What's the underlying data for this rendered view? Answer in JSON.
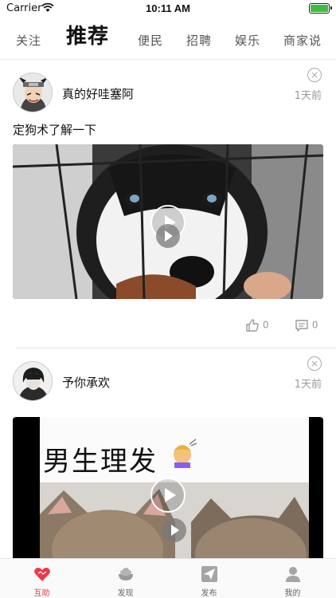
{
  "status_bar": {
    "carrier": "Carrier",
    "time": "10:11 AM"
  },
  "top_tabs": [
    {
      "label": "关注",
      "active": false
    },
    {
      "label": "推荐",
      "active": true
    },
    {
      "label": "便民",
      "active": false
    },
    {
      "label": "招聘",
      "active": false
    },
    {
      "label": "娱乐",
      "active": false
    },
    {
      "label": "商家说",
      "active": false
    }
  ],
  "posts": [
    {
      "username": "真的好哇塞阿",
      "time_ago": "1天前",
      "text": "定狗术了解一下",
      "likes": "0",
      "comments": "0"
    },
    {
      "username": "予你承欢",
      "time_ago": "1天前",
      "video_caption": "男生理发"
    }
  ],
  "bottom_nav": [
    {
      "label": "互助",
      "icon": "heart-icon",
      "active": true
    },
    {
      "label": "发现",
      "icon": "bowl-icon",
      "active": false
    },
    {
      "label": "发布",
      "icon": "send-icon",
      "active": false
    },
    {
      "label": "我的",
      "icon": "person-icon",
      "active": false
    }
  ],
  "colors": {
    "accent": "#e83a4a",
    "inactive": "#9a9a9a",
    "divider": "#e5e5e5"
  }
}
